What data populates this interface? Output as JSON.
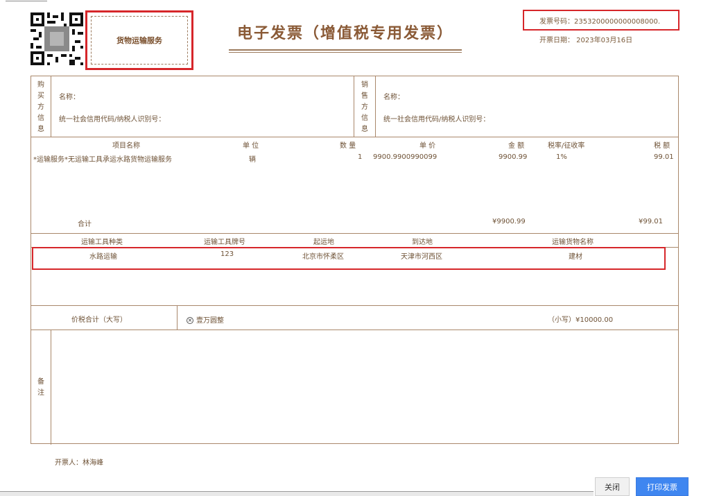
{
  "stamp": {
    "text": "货物运输服务"
  },
  "title": "电子发票（增值税专用发票）",
  "invoice": {
    "number": "发票号码：2353200000000008000.",
    "date": "开票日期： 2023年03月16日"
  },
  "buyer": {
    "section": "购买方信息",
    "name_label": "名称：",
    "tax_label": "统一社会信用代码/纳税人识别号："
  },
  "seller": {
    "section": "销售方信息",
    "name_label": "名称：",
    "tax_label": "统一社会信用代码/纳税人识别号："
  },
  "items": {
    "headers": {
      "name": "项目名称",
      "unit": "单 位",
      "qty": "数 量",
      "price": "单 价",
      "amount": "金 额",
      "rate": "税率/征收率",
      "tax": "税 额"
    },
    "rows": [
      {
        "name": "*运输服务*无运输工具承运水路货物运输服务",
        "unit": "辆",
        "qty": "1",
        "price": "9900.9900990099",
        "amount": "9900.99",
        "rate": "1%",
        "tax": "99.01"
      }
    ],
    "total_label": "合计",
    "total_amount": "¥9900.99",
    "total_tax": "¥99.01"
  },
  "transport": {
    "headers": {
      "type": "运输工具种类",
      "plate": "运输工具牌号",
      "origin": "起运地",
      "dest": "到达地",
      "goods": "运输货物名称"
    },
    "row": {
      "type": "水路运输",
      "plate": "123",
      "origin": "北京市怀柔区",
      "dest": "天津市河西区",
      "goods": "建材"
    }
  },
  "total": {
    "label": "价税合计（大写）",
    "upper": "壹万圆整",
    "lower": "（小写）¥10000.00"
  },
  "remarks": {
    "label": "备注"
  },
  "issuer": "开票人：林海峰",
  "buttons": {
    "close": "关闭",
    "print": "打印发票"
  },
  "colors": {
    "accent_red": "#d6262a",
    "line_brown": "#a9876a",
    "button_blue": "#3f86f0"
  }
}
